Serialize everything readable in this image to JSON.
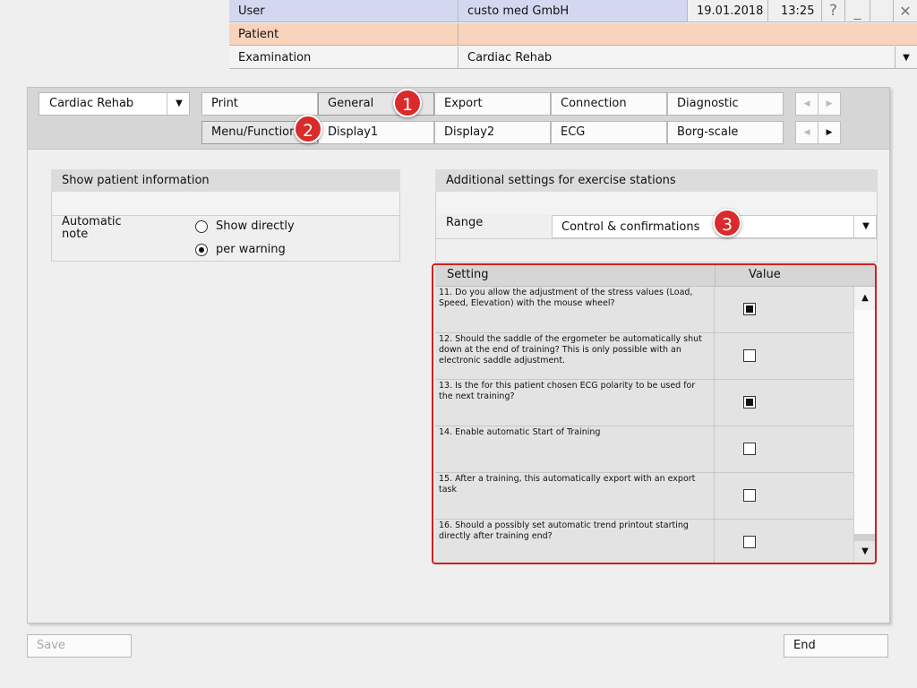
{
  "header": {
    "user_label": "User",
    "user_value": "custo med GmbH",
    "date": "19.01.2018",
    "time": "13:25",
    "help_symbol": "?",
    "minimize_symbol": "_",
    "close_symbol": "✕",
    "patient_label": "Patient",
    "patient_value": "",
    "examination_label": "Examination",
    "examination_value": "Cardiac Rehab"
  },
  "toolbar": {
    "profile_select": "Cardiac Rehab",
    "tabs_row1": [
      "Print",
      "General",
      "Export",
      "Connection",
      "Diagnostic"
    ],
    "tabs_row2": [
      "Menu/Functions",
      "Display1",
      "Display2",
      "ECG",
      "Borg-scale"
    ],
    "selected_tab_row1": "General",
    "selected_tab_row2": "Menu/Functions"
  },
  "left_panel": {
    "title": "Show patient information",
    "note_label": "Automatic note",
    "options": [
      "Show directly",
      "per warning"
    ],
    "selected_option": "per warning"
  },
  "right_panel": {
    "title": "Additional settings for exercise stations",
    "range_label": "Range",
    "range_value": "Control & confirmations",
    "table": {
      "col_setting": "Setting",
      "col_value": "Value",
      "rows": [
        {
          "text": "11. Do you allow the adjustment of the stress values (Load, Speed, Elevation) with the mouse wheel?",
          "checked": true
        },
        {
          "text": "12. Should the saddle of the ergometer be automatically shut down at the end of training?  This is only possible with an electronic saddle adjustment.",
          "checked": false
        },
        {
          "text": "13. Is the for this patient chosen ECG polarity to be used for the next training?",
          "checked": true
        },
        {
          "text": "14. Enable automatic Start of Training",
          "checked": false
        },
        {
          "text": "15. After a training, this automatically export with an export task",
          "checked": false
        },
        {
          "text": "16. Should a possibly set automatic trend printout starting directly after training end?",
          "checked": false
        }
      ]
    }
  },
  "callouts": [
    "1",
    "2",
    "3"
  ],
  "footer": {
    "save_label": "Save",
    "end_label": "End"
  },
  "colors": {
    "header_user_bg": "#d3d8f0",
    "header_patient_bg": "#f9d2bb",
    "callout_red": "#d92b2b",
    "highlight_border": "#d02020"
  }
}
